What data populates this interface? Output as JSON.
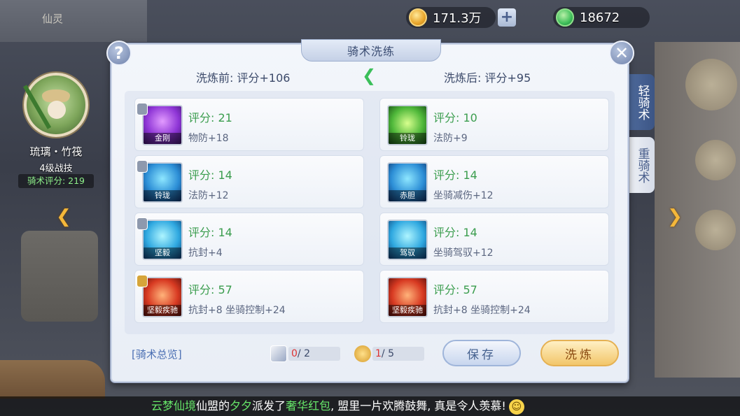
{
  "background": {
    "top_left_label": "仙灵"
  },
  "currency": {
    "gold_value": "171.3万",
    "jade_value": "18672"
  },
  "character": {
    "name": "琉璃・竹筏",
    "level": "4级战技",
    "score_text": "骑术评分: 219"
  },
  "side_tabs": {
    "light": "轻骑术",
    "heavy": "重骑术"
  },
  "dialog": {
    "title": "骑术洗练",
    "before": "洗炼前: 评分+106",
    "after": "洗炼后: 评分+95",
    "help": "?",
    "close": "✕",
    "before_cards": [
      {
        "score": "评分: 21",
        "attr": "物防+18",
        "tag": "金刚",
        "icon_color": "purple",
        "lock": "gray"
      },
      {
        "score": "评分: 14",
        "attr": "法防+12",
        "tag": "铃珑",
        "icon_color": "blue",
        "lock": "gray"
      },
      {
        "score": "评分: 14",
        "attr": "抗封+4",
        "tag": "坚毅",
        "icon_color": "blue",
        "lock": "gray"
      },
      {
        "score": "评分: 57",
        "attr": "抗封+8  坐骑控制+24",
        "tag": "坚毅疾驰",
        "icon_color": "red",
        "lock": "gold"
      }
    ],
    "after_cards": [
      {
        "score": "评分: 10",
        "attr": "法防+9",
        "tag": "铃珑",
        "icon_color": "green"
      },
      {
        "score": "评分: 14",
        "attr": "坐骑减伤+12",
        "tag": "赤胆",
        "icon_color": "blue"
      },
      {
        "score": "评分: 14",
        "attr": "坐骑驾驭+12",
        "tag": "驾驭",
        "icon_color": "blue"
      },
      {
        "score": "评分: 57",
        "attr": "抗封+8  坐骑控制+24",
        "tag": "坚毅疾驰",
        "icon_color": "red"
      }
    ],
    "overview_link": "[骑术总览]",
    "counter1": {
      "current": "0",
      "total": "/ 2"
    },
    "counter2": {
      "current": "1",
      "total": "/ 5"
    },
    "save_button": "保存",
    "refine_button": "洗炼"
  },
  "broadcast": {
    "part1": "云梦仙境",
    "part2": "仙盟的",
    "part3": "夕夕",
    "part4": "派发了",
    "part5": "奢华红包",
    "part6": ", 盟里一片欢腾鼓舞, 真是令人羡慕!"
  },
  "colors": {
    "score_green": "#3b9d4e",
    "link_blue": "#4b6fb3",
    "accent_orange": "#f4b73a"
  }
}
